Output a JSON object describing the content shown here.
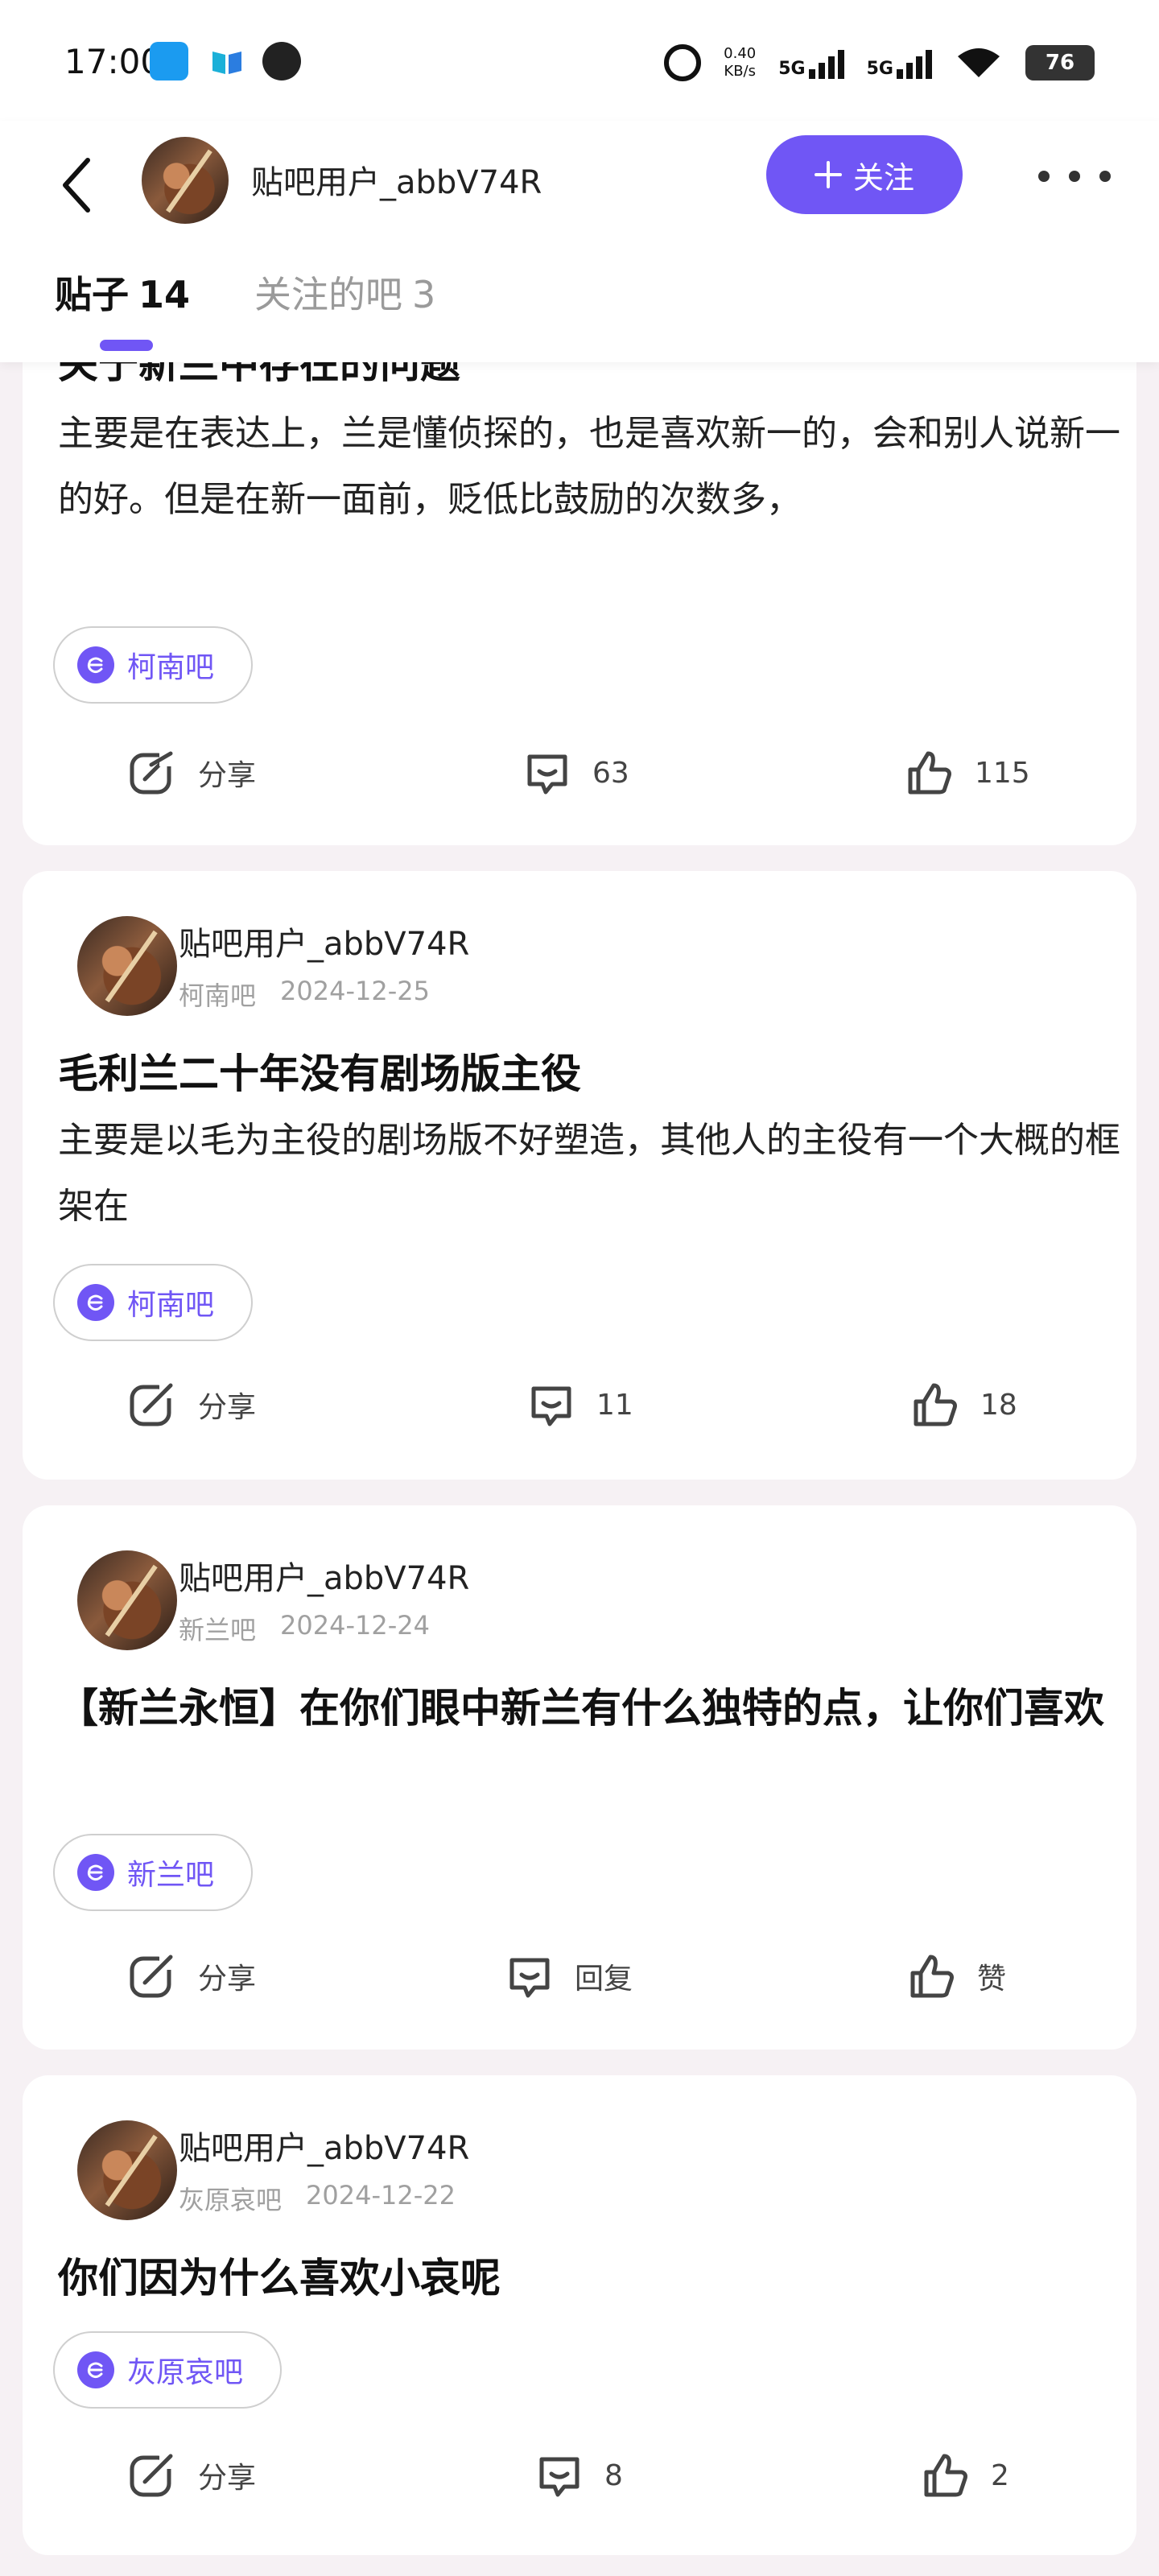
{
  "status_bar": {
    "time": "17:00",
    "speed_value": "0.40",
    "speed_unit": "KB/s",
    "network1": "5G",
    "network2": "5G",
    "battery": "76"
  },
  "header": {
    "username": "贴吧用户_abbV74R",
    "follow_label": "关注"
  },
  "tabs": [
    {
      "label": "贴子",
      "count": "14"
    },
    {
      "label": "关注的吧",
      "count": "3"
    }
  ],
  "posts": [
    {
      "title": "关于新兰中存在的问题",
      "body": "主要是在表达上，兰是懂侦探的，也是喜欢新一的，会和别人说新一的好。但是在新一面前，贬低比鼓励的次数多，",
      "forum": "柯南吧",
      "share_label": "分享",
      "comments": "63",
      "likes": "115"
    },
    {
      "author": "贴吧用户_abbV74R",
      "forum_meta": "柯南吧",
      "date": "2024-12-25",
      "title": "毛利兰二十年没有剧场版主役",
      "body": "主要是以毛为主役的剧场版不好塑造，其他人的主役有一个大概的框架在",
      "forum": "柯南吧",
      "share_label": "分享",
      "comments": "11",
      "likes": "18"
    },
    {
      "author": "贴吧用户_abbV74R",
      "forum_meta": "新兰吧",
      "date": "2024-12-24",
      "title": "【新兰永恒】在你们眼中新兰有什么独特的点，让你们喜欢",
      "forum": "新兰吧",
      "share_label": "分享",
      "comments": "回复",
      "likes": "赞"
    },
    {
      "author": "贴吧用户_abbV74R",
      "forum_meta": "灰原哀吧",
      "date": "2024-12-22",
      "title": "你们因为什么喜欢小哀呢",
      "forum": "灰原哀吧",
      "share_label": "分享",
      "comments": "8",
      "likes": "2"
    }
  ],
  "colors": {
    "accent": "#7056f5",
    "background": "#f6f1f4"
  }
}
